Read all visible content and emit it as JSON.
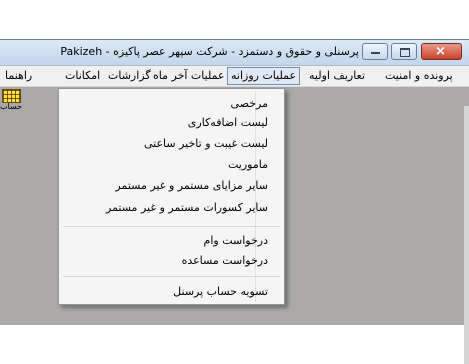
{
  "window": {
    "title": "پرسنلی و حقوق و دستمزد - شرکت سپهر عصر پاکیزه - Pakizeh",
    "controls": {
      "minimize": "minimize",
      "maximize": "maximize",
      "close": "×"
    }
  },
  "menubar": {
    "items": [
      {
        "label": "پرونده و امنیت"
      },
      {
        "label": "تعاریف اولیه"
      },
      {
        "label": "عملیات روزانه"
      },
      {
        "label": "عملیات آخر ماه"
      },
      {
        "label": "گزارشات"
      },
      {
        "label": "امکانات"
      },
      {
        "label": "راهنما"
      }
    ]
  },
  "toolbar": {
    "item_label": "حساب"
  },
  "dropdown": {
    "items": [
      {
        "label": "مرخصی"
      },
      {
        "label": "لیست اضافه‌کاری"
      },
      {
        "label": "لیست غیبت و تاخیر ساعتی"
      },
      {
        "label": "ماموریت"
      },
      {
        "label": "سایر مزایای مستمر و غیر مستمر"
      },
      {
        "label": "سایر کسورات مستمر و غیر مستمر"
      },
      {
        "label": "درخواست وام"
      },
      {
        "label": "درخواست مساعده"
      },
      {
        "label": "تسویه حساب پرسنل"
      }
    ]
  }
}
